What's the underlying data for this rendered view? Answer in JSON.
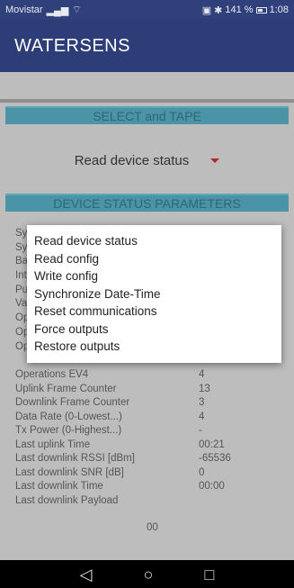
{
  "status_bar": {
    "carrier": "Movistar",
    "battery": "141 %",
    "time": "1:08"
  },
  "app_bar": {
    "title": "WATERSENS"
  },
  "select_section": {
    "header": "SELECT and TAPE",
    "selected_value": "Read device status"
  },
  "status_section": {
    "header": "DEVICE STATUS PARAMETERS"
  },
  "partial_labels": [
    "Sy",
    "Sy",
    "Ba",
    "Int",
    "Pu",
    "Va",
    "Op",
    "Op",
    "Op"
  ],
  "params": [
    {
      "key": "Operations EV4",
      "value": "4"
    },
    {
      "key": "Uplink Frame Counter",
      "value": "13"
    },
    {
      "key": "Downlink Frame Counter",
      "value": "3"
    },
    {
      "key": "Data Rate (0-Lowest...)",
      "value": "4"
    },
    {
      "key": "Tx Power (0-Highest...)",
      "value": "-"
    },
    {
      "key": "Last uplink Time",
      "value": "00:21"
    },
    {
      "key": "Last downlink RSSI [dBm]",
      "value": "-65536"
    },
    {
      "key": "Last downlink SNR [dB]",
      "value": "0"
    },
    {
      "key": "Last downlink Time",
      "value": "00:00"
    },
    {
      "key": "Last downlink Payload",
      "value": ""
    }
  ],
  "payload_value": "00",
  "dialog": {
    "items": [
      "Read device status",
      "Read config",
      "Write config",
      "Synchronize Date-Time",
      "Reset communications",
      "Force outputs",
      "Restore outputs"
    ]
  },
  "nav": {
    "back_icon": "back-icon",
    "home_icon": "home-icon",
    "recents_icon": "recents-icon"
  }
}
